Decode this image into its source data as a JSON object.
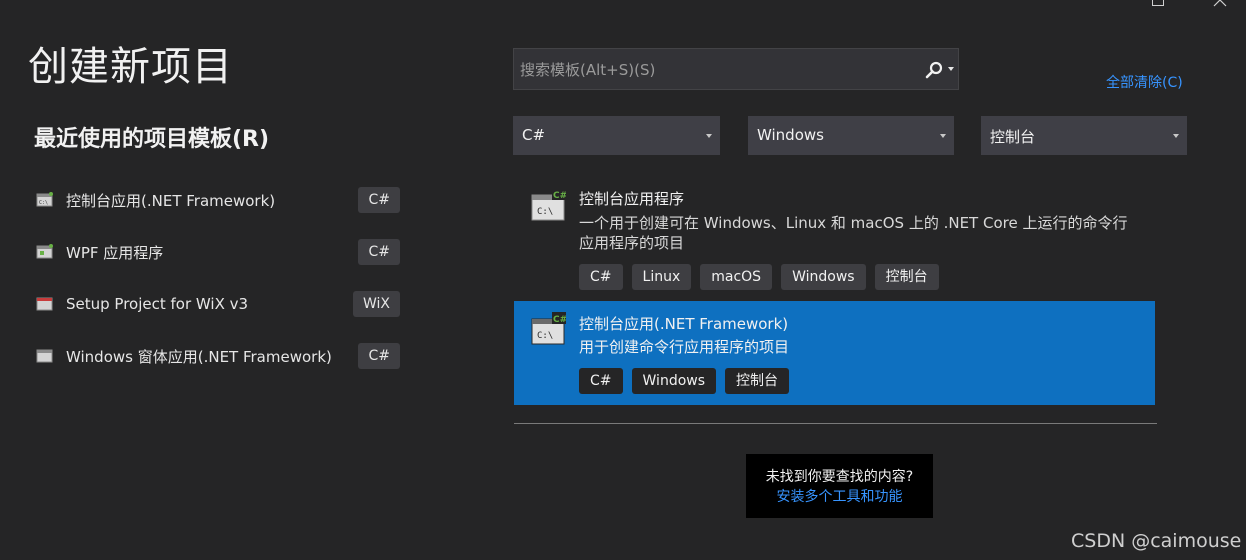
{
  "page": {
    "title": "创建新项目",
    "recent_heading": "最近使用的项目模板(R)",
    "clear_all": "全部清除(C)"
  },
  "recent_templates": [
    {
      "label": "控制台应用(.NET Framework)",
      "lang": "C#",
      "icon": "console-app-icon"
    },
    {
      "label": "WPF 应用程序",
      "lang": "C#",
      "icon": "wpf-app-icon"
    },
    {
      "label": "Setup Project for WiX v3",
      "lang": "WiX",
      "icon": "setup-project-icon"
    },
    {
      "label": "Windows 窗体应用(.NET Framework)",
      "lang": "C#",
      "icon": "windows-forms-icon"
    }
  ],
  "search": {
    "placeholder": "搜索模板(Alt+S)(S)",
    "value": ""
  },
  "filters": {
    "language": "C#",
    "platform": "Windows",
    "project_type": "控制台"
  },
  "templates": [
    {
      "title": "控制台应用程序",
      "description": "一个用于创建可在 Windows、Linux 和 macOS 上的 .NET Core 上运行的命令行应用程序的项目",
      "tags": [
        "C#",
        "Linux",
        "macOS",
        "Windows",
        "控制台"
      ],
      "selected": false
    },
    {
      "title": "控制台应用(.NET Framework)",
      "description": "用于创建命令行应用程序的项目",
      "tags": [
        "C#",
        "Windows",
        "控制台"
      ],
      "selected": true
    }
  ],
  "not_found": {
    "question": "未找到你要查找的内容?",
    "link": "安装多个工具和功能"
  },
  "watermark": "CSDN @caimouse",
  "colors": {
    "background": "#252526",
    "selected": "#0e70c0",
    "link": "#3794ff"
  }
}
